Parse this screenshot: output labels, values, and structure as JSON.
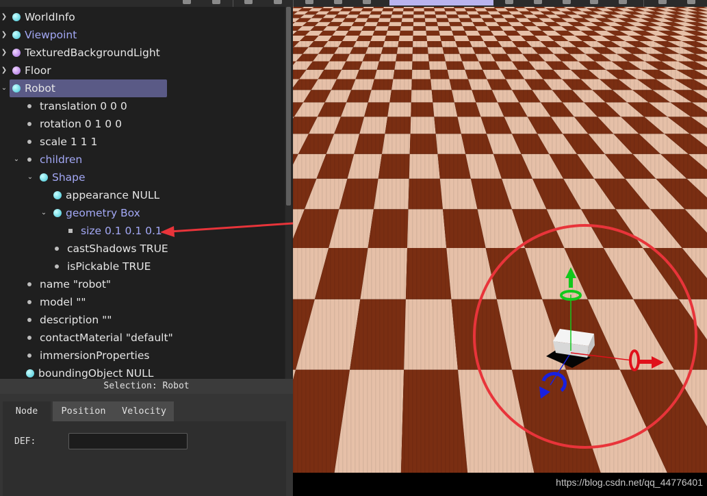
{
  "scene_tree": {
    "items": [
      {
        "label": "WorldInfo"
      },
      {
        "label": "Viewpoint"
      },
      {
        "label": "TexturedBackgroundLight"
      },
      {
        "label": "Floor"
      },
      {
        "label": "Robot"
      },
      {
        "label": "translation 0 0 0"
      },
      {
        "label": "rotation 0 1 0 0"
      },
      {
        "label": "scale 1 1 1"
      },
      {
        "label": "children"
      },
      {
        "label": "Shape"
      },
      {
        "label": "appearance NULL"
      },
      {
        "label": "geometry Box"
      },
      {
        "label": "size 0.1 0.1 0.1"
      },
      {
        "label": "castShadows TRUE"
      },
      {
        "label": "isPickable TRUE"
      },
      {
        "label": "name \"robot\""
      },
      {
        "label": "model \"\""
      },
      {
        "label": "description \"\""
      },
      {
        "label": "contactMaterial \"default\""
      },
      {
        "label": "immersionProperties"
      },
      {
        "label": "boundingObject NULL"
      }
    ]
  },
  "status_bar": {
    "text": "Selection: Robot"
  },
  "properties": {
    "tabs": [
      {
        "label": "Node"
      },
      {
        "label": "Position"
      },
      {
        "label": "Velocity"
      }
    ],
    "def_label": "DEF:",
    "def_value": ""
  },
  "watermark": "https://blog.csdn.net/qq_44776401",
  "colors": {
    "selection": "#5a5a86",
    "node_highlight": "#a3a8f5",
    "annotation": "#e8343a",
    "axis_x": "#e0101a",
    "axis_y": "#12c81c",
    "axis_z": "#1820e0",
    "checker_dark": "#7a2e12",
    "checker_light": "#e6c0a8"
  }
}
